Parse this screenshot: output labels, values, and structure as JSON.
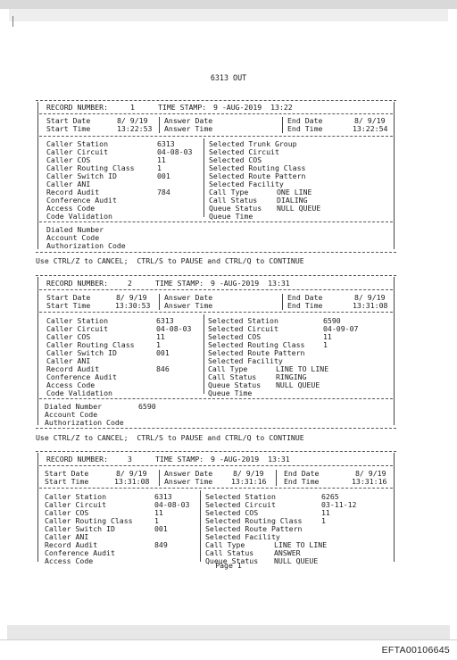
{
  "document": {
    "header": "6313 OUT",
    "control_hint": "Use CTRL/Z to CANCEL;  CTRL/S to PAUSE and CTRL/Q to CONTINUE",
    "page_label": "Page 1",
    "bates_number": "EFTA00106645"
  },
  "labels": {
    "record_number": "RECORD NUMBER:",
    "time_stamp": "TIME STAMP:",
    "start_date": "Start Date",
    "start_time": "Start Time",
    "answer_date": "Answer Date",
    "answer_time": "Answer Time",
    "end_date": "End Date",
    "end_time": "End Time",
    "left_fields": [
      "Caller Station",
      "Caller Circuit",
      "Caller COS",
      "Caller Routing Class",
      "Caller Switch ID",
      "Caller ANI",
      "Record Audit",
      "Conference Audit",
      "Access Code",
      "Code Validation"
    ],
    "right_fields_r1": [
      "Selected Trunk Group",
      "Selected Circuit",
      "Selected COS",
      "Selected Routing Class",
      "Selected Route Pattern",
      "Selected Facility",
      "Call Type",
      "Call Status",
      "Queue Status",
      "Queue Time"
    ],
    "right_fields": [
      "Selected Station",
      "Selected Circuit",
      "Selected COS",
      "Selected Routing Class",
      "Selected Route Pattern",
      "Selected Facility",
      "Call Type",
      "Call Status",
      "Queue Status",
      "Queue Time"
    ],
    "dialed_fields": [
      "Dialed Number",
      "Account Code",
      "Authorization Code"
    ]
  },
  "records": [
    {
      "number": "1",
      "timestamp": "9 -AUG-2019  13:22",
      "start_date": "8/ 9/19",
      "start_time": "13:22:53",
      "answer_date": "",
      "answer_time": "",
      "end_date": "8/ 9/19",
      "end_time": "13:22:54",
      "left_values": [
        "6313",
        "04-08-03",
        "11",
        "1",
        "001",
        "",
        "784",
        "",
        "",
        ""
      ],
      "right_values": [
        "",
        "",
        "",
        "",
        "",
        "",
        "ONE LINE",
        "DIALING",
        "NULL QUEUE",
        ""
      ],
      "dialed_values": [
        "",
        "",
        ""
      ]
    },
    {
      "number": "2",
      "timestamp": "9 -AUG-2019  13:31",
      "start_date": "8/ 9/19",
      "start_time": "13:30:53",
      "answer_date": "",
      "answer_time": "",
      "end_date": "8/ 9/19",
      "end_time": "13:31:08",
      "left_values": [
        "6313",
        "04-08-03",
        "11",
        "1",
        "001",
        "",
        "846",
        "",
        "",
        ""
      ],
      "right_values": [
        "6590",
        "04-09-07",
        "11",
        "1",
        "",
        "",
        "LINE TO LINE",
        "RINGING",
        "NULL QUEUE",
        ""
      ],
      "dialed_values": [
        "6590",
        "",
        ""
      ]
    },
    {
      "number": "3",
      "timestamp": "9 -AUG-2019  13:31",
      "start_date": "8/ 9/19",
      "start_time": "13:31:08",
      "answer_date": "8/ 9/19",
      "answer_time": "13:31:16",
      "end_date": "8/ 9/19",
      "end_time": "13:31:16",
      "left_values": [
        "6313",
        "04-08-03",
        "11",
        "1",
        "001",
        "",
        "849",
        "",
        ""
      ],
      "right_values": [
        "6265",
        "03-11-12",
        "11",
        "1",
        "",
        "",
        "LINE TO LINE",
        "ANSWER",
        "NULL QUEUE"
      ]
    }
  ]
}
